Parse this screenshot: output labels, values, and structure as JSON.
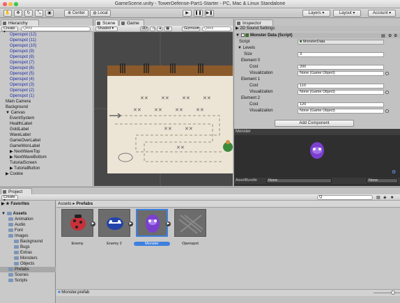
{
  "window": {
    "title": "GameScene.unity - TowerDefense-Part1-Starter - PC, Mac & Linux Standalone"
  },
  "toolbar": {
    "transform_tools": [
      "hand-tool",
      "move-tool",
      "rotate-tool",
      "scale-tool",
      "rect-tool"
    ],
    "pivot_label": "Center",
    "space_label": "Local",
    "layers_label": "Layers",
    "layout_label": "Layout",
    "account_label": "Account"
  },
  "hierarchy": {
    "tab": "Hierarchy",
    "create": "Create",
    "search_placeholder": "Q▾All",
    "items": [
      {
        "label": "Openspot (12)",
        "type": "prefab",
        "indent": 1
      },
      {
        "label": "Openspot (11)",
        "type": "prefab",
        "indent": 1
      },
      {
        "label": "Openspot (10)",
        "type": "prefab",
        "indent": 1
      },
      {
        "label": "Openspot (9)",
        "type": "prefab",
        "indent": 1
      },
      {
        "label": "Openspot (8)",
        "type": "prefab",
        "indent": 1
      },
      {
        "label": "Openspot (7)",
        "type": "prefab",
        "indent": 1
      },
      {
        "label": "Openspot (6)",
        "type": "prefab",
        "indent": 1
      },
      {
        "label": "Openspot (5)",
        "type": "prefab",
        "indent": 1
      },
      {
        "label": "Openspot (4)",
        "type": "prefab",
        "indent": 1
      },
      {
        "label": "Openspot (3)",
        "type": "prefab",
        "indent": 1
      },
      {
        "label": "Openspot (2)",
        "type": "prefab",
        "indent": 1
      },
      {
        "label": "Openspot (1)",
        "type": "prefab",
        "indent": 1
      },
      {
        "label": "Main Camera",
        "type": "object",
        "indent": 0
      },
      {
        "label": "Background",
        "type": "object",
        "indent": 0
      },
      {
        "label": "▼ Canvas",
        "type": "object",
        "indent": 0
      },
      {
        "label": "EventSystem",
        "type": "object",
        "indent": 1
      },
      {
        "label": "HealthLabel",
        "type": "object",
        "indent": 1
      },
      {
        "label": "GoldLabel",
        "type": "object",
        "indent": 1
      },
      {
        "label": "WaveLabel",
        "type": "object",
        "indent": 1
      },
      {
        "label": "GameOverLabel",
        "type": "object",
        "indent": 1
      },
      {
        "label": "GameWonLabel",
        "type": "object",
        "indent": 1
      },
      {
        "label": "▶ NextWaveTop",
        "type": "object",
        "indent": 1
      },
      {
        "label": "▶ NextWaveBottom",
        "type": "object",
        "indent": 1
      },
      {
        "label": "TutorialScreen",
        "type": "object",
        "indent": 1
      },
      {
        "label": "▶ TutorialButton",
        "type": "object",
        "indent": 1
      },
      {
        "label": "▶ Cookie",
        "type": "object",
        "indent": 0
      }
    ]
  },
  "scene": {
    "tab_scene": "Scene",
    "tab_game": "Game",
    "shading": "Shaded",
    "mode_2d": "2D",
    "gizmos": "Gizmos",
    "search_placeholder": "Q▾All"
  },
  "inspector": {
    "tab": "Inspector",
    "component_above": "2D Sound Settings",
    "component_title": "Monster Data (Script)",
    "script_label": "Script",
    "script_value": "MonsterData",
    "levels_label": "Levels",
    "size_label": "Size",
    "size_value": "3",
    "elements": [
      {
        "label": "Element 0",
        "cost_label": "Cost",
        "cost": "200",
        "vis_label": "Visualization",
        "vis": "None (Game Object)"
      },
      {
        "label": "Element 1",
        "cost_label": "Cost",
        "cost": "110",
        "vis_label": "Visualization",
        "vis": "None (Game Object)"
      },
      {
        "label": "Element 2",
        "cost_label": "Cost",
        "cost": "120",
        "vis_label": "Visualization",
        "vis": "None (Game Object)"
      }
    ],
    "add_component": "Add Component",
    "preview_title": "Monster",
    "assetbundle_label": "AssetBundle",
    "assetbundle_value": "None",
    "assetbundle_variant": "None"
  },
  "project": {
    "tab": "Project",
    "create": "Create",
    "favorites": "Favorites",
    "assets_root": "Assets",
    "breadcrumb_root": "Assets",
    "breadcrumb_sep": "▸",
    "breadcrumb_current": "Prefabs",
    "tree": [
      {
        "label": "Animation",
        "level": 1
      },
      {
        "label": "Audio",
        "level": 1
      },
      {
        "label": "Font",
        "level": 1
      },
      {
        "label": "Images",
        "level": 1
      },
      {
        "label": "Background",
        "level": 2
      },
      {
        "label": "Bugs",
        "level": 2
      },
      {
        "label": "Extras",
        "level": 2
      },
      {
        "label": "Monsters",
        "level": 2
      },
      {
        "label": "Objects",
        "level": 2
      },
      {
        "label": "Prefabs",
        "level": 1
      },
      {
        "label": "Scenes",
        "level": 1
      },
      {
        "label": "Scripts",
        "level": 1
      }
    ],
    "assets": [
      {
        "label": "Enemy"
      },
      {
        "label": "Enemy 2"
      },
      {
        "label": "Monster"
      },
      {
        "label": "Openspot"
      }
    ],
    "status_file": "Monster.prefab"
  },
  "colors": {
    "selection": "#3d80df",
    "prefab_text": "#1a2aa8",
    "panel_bg": "#c2c2c2",
    "scene_bg": "#484848"
  }
}
